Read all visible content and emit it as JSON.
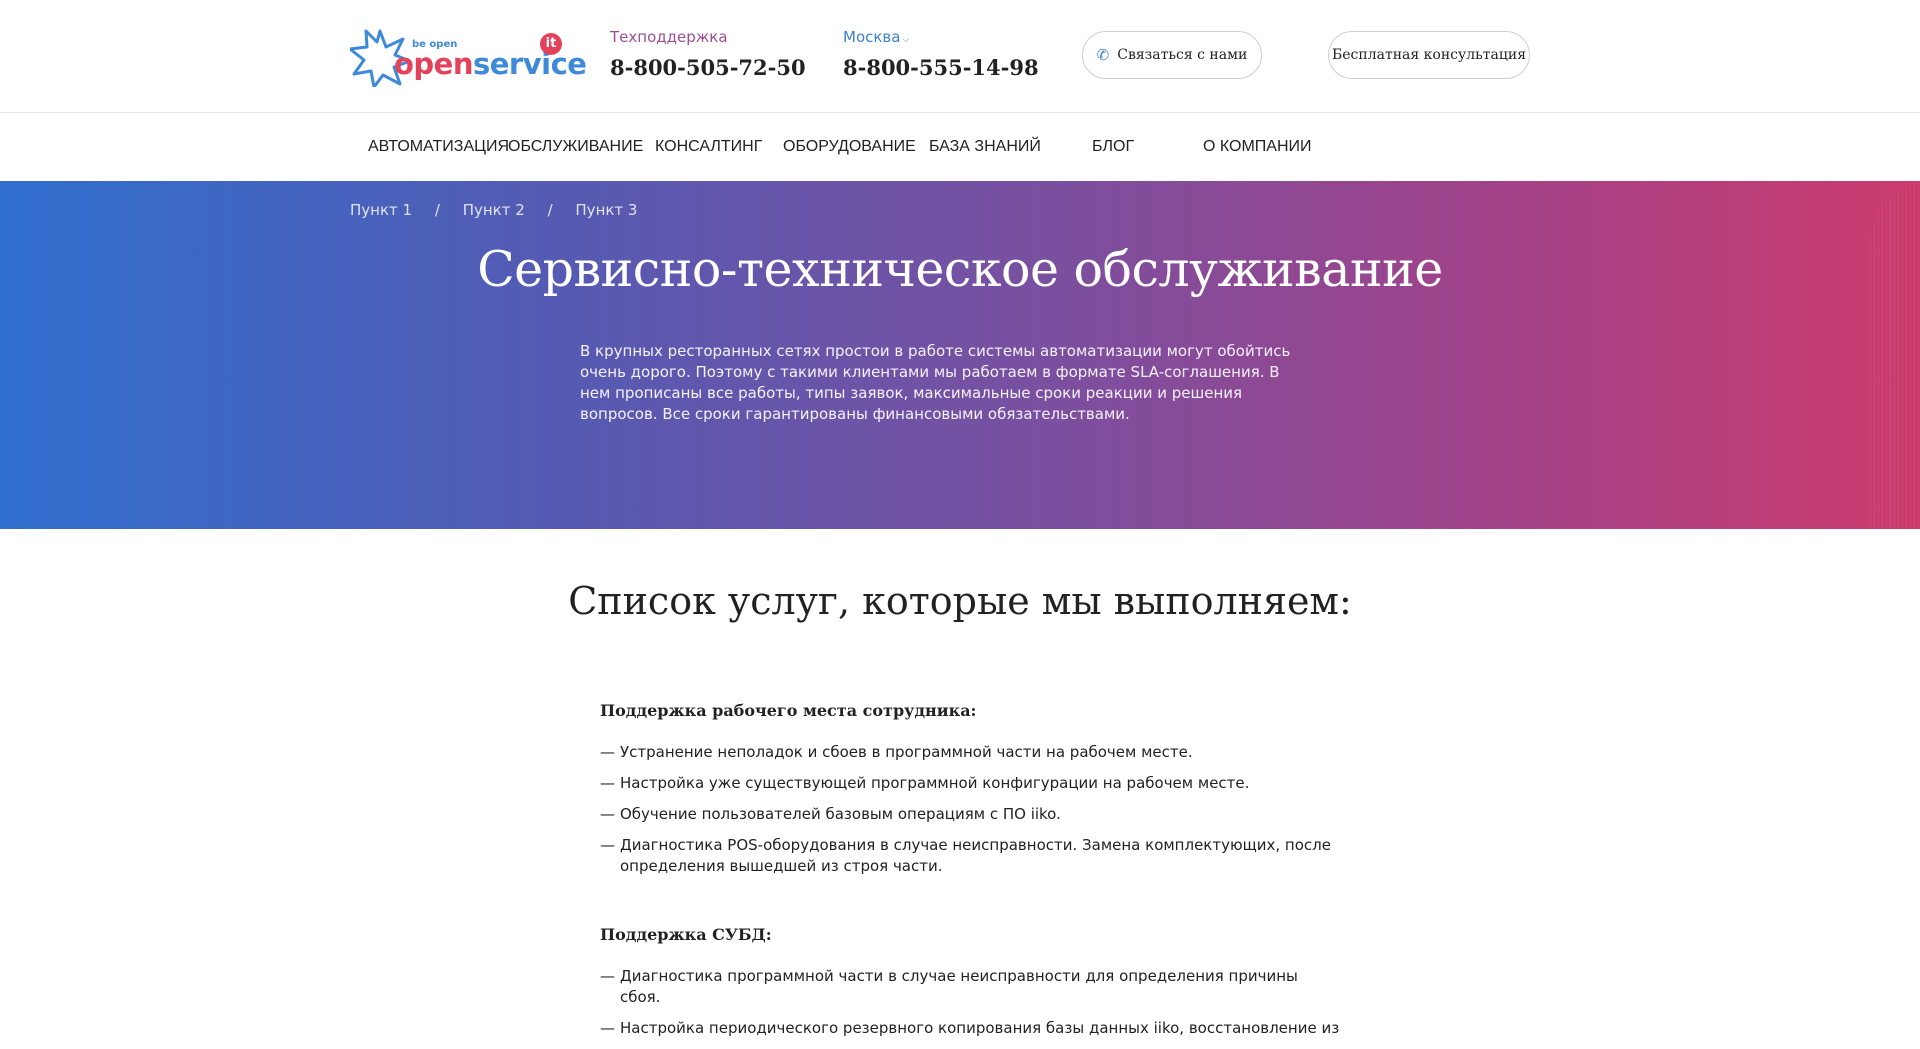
{
  "header": {
    "logo": {
      "tagline": "be open",
      "brand_open": "open",
      "brand_service": "service",
      "badge": "it"
    },
    "support": {
      "label": "Техподдержка",
      "phone": "8-800-505-72-50"
    },
    "city": {
      "label": "Москва",
      "phone": "8-800-555-14-98"
    },
    "call_button": "Связаться с нами",
    "consult_button": "Бесплатная консультация"
  },
  "nav": {
    "items": [
      "Автоматизация",
      "Обслуживание",
      "Консалтинг",
      "Оборудование",
      "База знаний",
      "Блог",
      "О компании"
    ]
  },
  "hero": {
    "breadcrumbs": [
      "Пункт 1",
      "Пункт 2",
      "Пункт 3"
    ],
    "separator": "/",
    "title": "Сервисно-техническое обслуживание",
    "text": "В крупных ресторанных сетях простои в работе системы автоматизации могут обойтись очень дорого. Поэтому с такими клиентами мы работаем в формате SLA-соглашения. В нем прописаны все работы, типы заявок, максимальные сроки реакции и решения вопросов. Все сроки гарантированы финансовыми обязательствами."
  },
  "content": {
    "title": "Список услуг, которые мы выполняем:",
    "sections": [
      {
        "heading": "Поддержка рабочего места сотрудника:",
        "items": [
          "Устранение неполадок и сбоев в программной части на рабочем месте.",
          "Настройка уже существующей программной конфигурации на рабочем месте.",
          "Обучение пользователей базовым операциям с ПО iiko.",
          "Диагностика POS-оборудования в случае неисправности. Замена комплектующих, после определения вышедшей из строя части."
        ]
      },
      {
        "heading": "Поддержка СУБД:",
        "items": [
          "Диагностика программной части в случае неисправности для определения причины сбоя.",
          "Настройка периодического резервного копирования базы данных iiko, восстановление из"
        ]
      }
    ],
    "dash": "—"
  },
  "colors": {
    "brand_red": "#e4415b",
    "brand_blue": "#3e8ad8",
    "gradient_start": "#2f6fcf",
    "gradient_end": "#cc3b6d"
  }
}
